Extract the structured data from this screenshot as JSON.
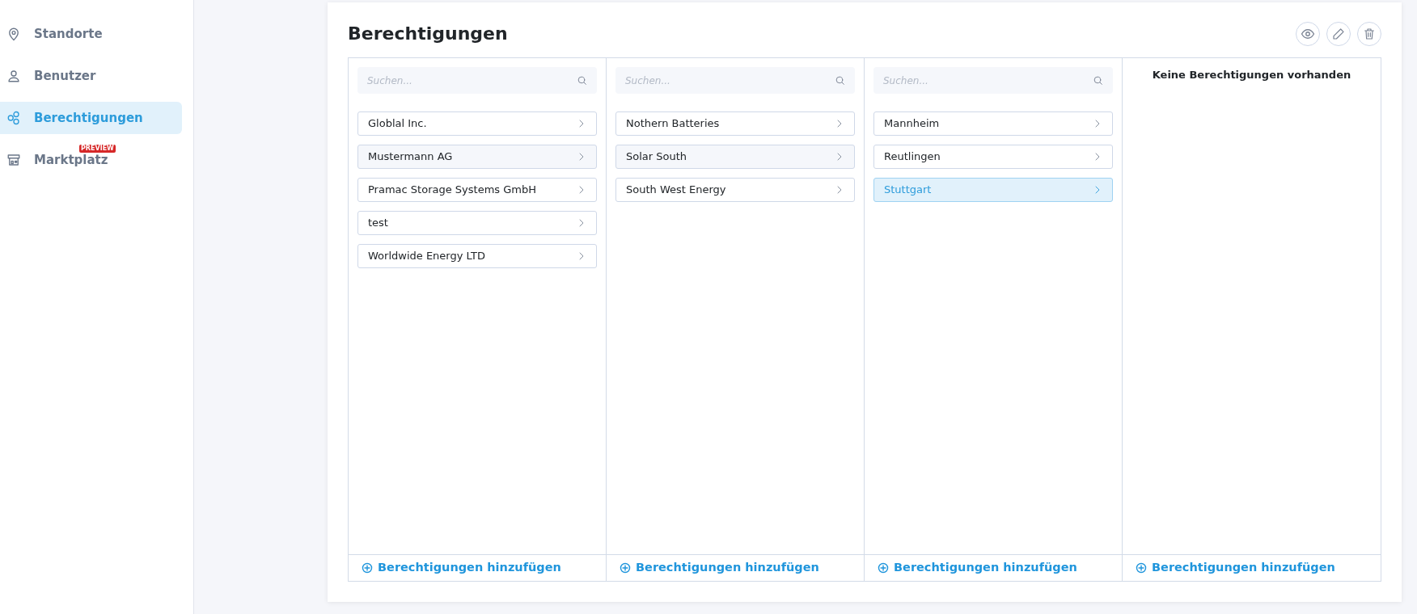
{
  "sidebar": {
    "items": [
      {
        "label": "Standorte",
        "selected": false
      },
      {
        "label": "Benutzer",
        "selected": false
      },
      {
        "label": "Berechtigungen",
        "selected": true
      },
      {
        "label": "Marktplatz",
        "selected": false,
        "badge": "PREVIEW"
      }
    ]
  },
  "panel": {
    "title": "Berechtigungen",
    "columns": [
      {
        "kind": "list",
        "focused": false,
        "search": {
          "placeholder": "Suchen..."
        },
        "items": [
          {
            "label": "Globlal Inc.",
            "selected": false
          },
          {
            "label": "Mustermann AG",
            "selected": true
          },
          {
            "label": "Pramac Storage Systems GmbH",
            "selected": false
          },
          {
            "label": "test",
            "selected": false
          },
          {
            "label": "Worldwide Energy LTD",
            "selected": false
          }
        ],
        "add_label": "Berechtigungen hinzufügen"
      },
      {
        "kind": "list",
        "focused": false,
        "search": {
          "placeholder": "Suchen..."
        },
        "items": [
          {
            "label": "Nothern Batteries",
            "selected": false
          },
          {
            "label": "Solar South",
            "selected": true
          },
          {
            "label": "South West Energy",
            "selected": false
          }
        ],
        "add_label": "Berechtigungen hinzufügen"
      },
      {
        "kind": "list",
        "focused": true,
        "search": {
          "placeholder": "Suchen..."
        },
        "items": [
          {
            "label": "Mannheim",
            "selected": false
          },
          {
            "label": "Reutlingen",
            "selected": false
          },
          {
            "label": "Stuttgart",
            "selected": true
          }
        ],
        "add_label": "Berechtigungen hinzufügen"
      },
      {
        "kind": "empty",
        "message": "Keine Berechtigungen vorhanden",
        "add_label": "Berechtigungen hinzufügen"
      }
    ]
  }
}
